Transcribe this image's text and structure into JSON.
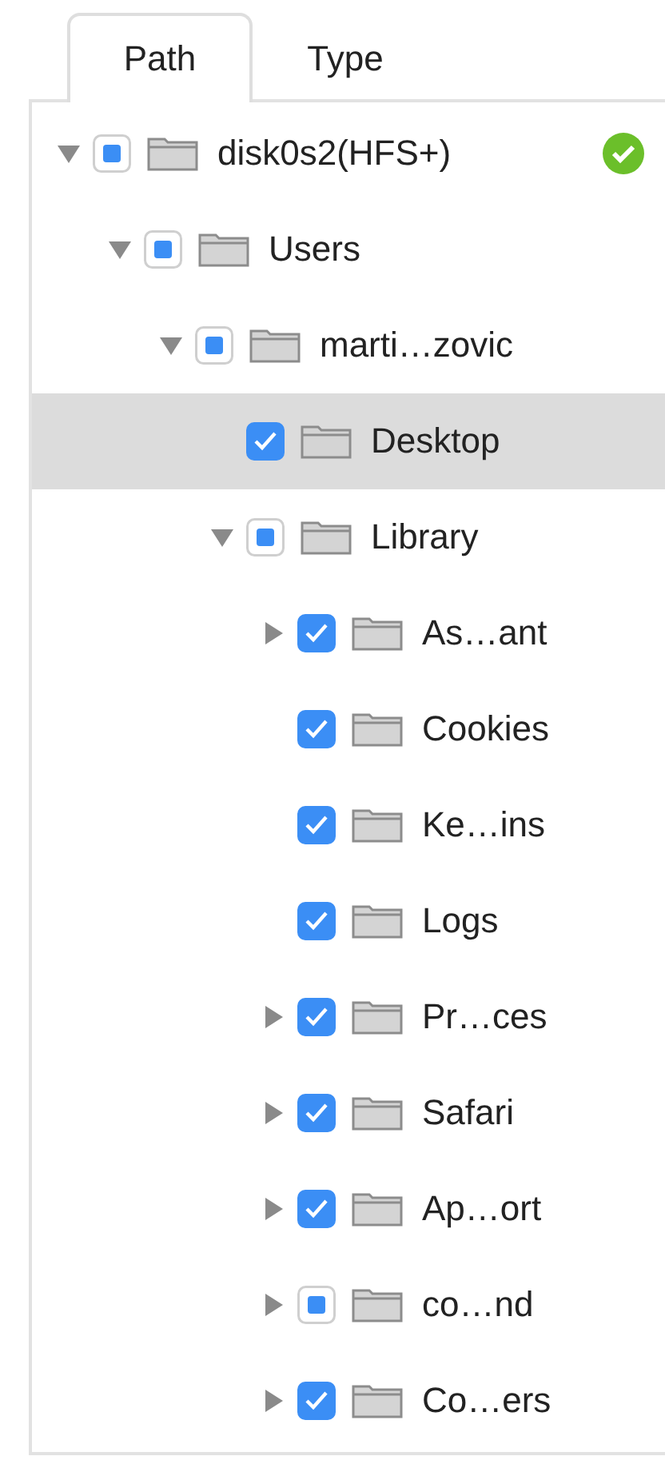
{
  "tabs": [
    {
      "label": "Path",
      "selected": true
    },
    {
      "label": "Type",
      "selected": false
    }
  ],
  "tree": [
    {
      "name": "disk0s2(HFS+)",
      "mixed": true,
      "expandable": true,
      "expanded": true,
      "selected": false,
      "verified": true,
      "children": [
        {
          "name": "Users",
          "mixed": true,
          "expandable": true,
          "expanded": true,
          "selected": false,
          "verified": false,
          "children": [
            {
              "name": "marti…zovic",
              "mixed": true,
              "expandable": true,
              "expanded": true,
              "selected": false,
              "verified": false,
              "children": [
                {
                  "name": "Desktop",
                  "mixed": false,
                  "expandable": false,
                  "selected": true,
                  "verified": false
                },
                {
                  "name": "Library",
                  "mixed": true,
                  "expandable": true,
                  "expanded": true,
                  "selected": false,
                  "verified": false,
                  "children": [
                    {
                      "name": "As…ant",
                      "mixed": false,
                      "expandable": true,
                      "expanded": false,
                      "selected": false,
                      "verified": false
                    },
                    {
                      "name": "Cookies",
                      "mixed": false,
                      "expandable": false,
                      "selected": false,
                      "verified": false
                    },
                    {
                      "name": "Ke…ins",
                      "mixed": false,
                      "expandable": false,
                      "selected": false,
                      "verified": false
                    },
                    {
                      "name": "Logs",
                      "mixed": false,
                      "expandable": false,
                      "selected": false,
                      "verified": false
                    },
                    {
                      "name": "Pr…ces",
                      "mixed": false,
                      "expandable": true,
                      "expanded": false,
                      "selected": false,
                      "verified": false
                    },
                    {
                      "name": "Safari",
                      "mixed": false,
                      "expandable": true,
                      "expanded": false,
                      "selected": false,
                      "verified": false
                    },
                    {
                      "name": "Ap…ort",
                      "mixed": false,
                      "expandable": true,
                      "expanded": false,
                      "selected": false,
                      "verified": false
                    },
                    {
                      "name": "co…nd",
                      "mixed": true,
                      "expandable": true,
                      "expanded": false,
                      "selected": false,
                      "verified": false
                    },
                    {
                      "name": "Co…ers",
                      "mixed": false,
                      "expandable": true,
                      "expanded": false,
                      "selected": false,
                      "verified": false
                    }
                  ]
                }
              ]
            }
          ]
        }
      ]
    }
  ]
}
